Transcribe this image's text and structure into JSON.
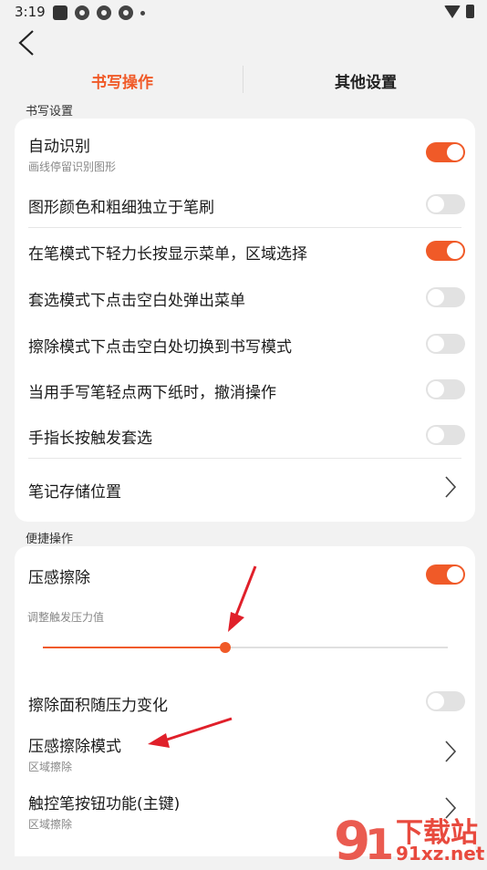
{
  "status_bar": {
    "time": "3:19"
  },
  "tabs": [
    {
      "label": "书写操作",
      "active": true
    },
    {
      "label": "其他设置",
      "active": false
    }
  ],
  "section_writing": {
    "label": "书写设置",
    "rows": [
      {
        "title": "自动识别",
        "subtitle": "画线停留识别图形",
        "toggle": true
      },
      {
        "title": "图形颜色和粗细独立于笔刷",
        "toggle": false
      },
      {
        "title": "在笔模式下轻力长按显示菜单，区域选择",
        "toggle": true
      },
      {
        "title": "套选模式下点击空白处弹出菜单",
        "toggle": false
      },
      {
        "title": "擦除模式下点击空白处切换到书写模式",
        "toggle": false
      },
      {
        "title": "当用手写笔轻点两下纸时，撤消操作",
        "toggle": false
      },
      {
        "title": "手指长按触发套选",
        "toggle": false
      },
      {
        "title": "笔记存储位置"
      }
    ]
  },
  "section_shortcut": {
    "label": "便捷操作",
    "pressure_erase": {
      "title": "压感擦除",
      "toggle": true
    },
    "slider": {
      "label": "调整触发压力值",
      "value_fraction": 0.45
    },
    "area_follow_pressure": {
      "title": "擦除面积随压力变化",
      "toggle": false
    },
    "pressure_erase_mode": {
      "title": "压感擦除模式",
      "subtitle": "区域擦除"
    },
    "stylus_button": {
      "title": "触控笔按钮功能(主键)",
      "subtitle": "区域擦除"
    }
  },
  "watermark": {
    "text_cn": "下载站",
    "text_url": "91xz.net"
  },
  "colors": {
    "accent": "#f05a28",
    "annotation_arrow": "#e0202a"
  }
}
